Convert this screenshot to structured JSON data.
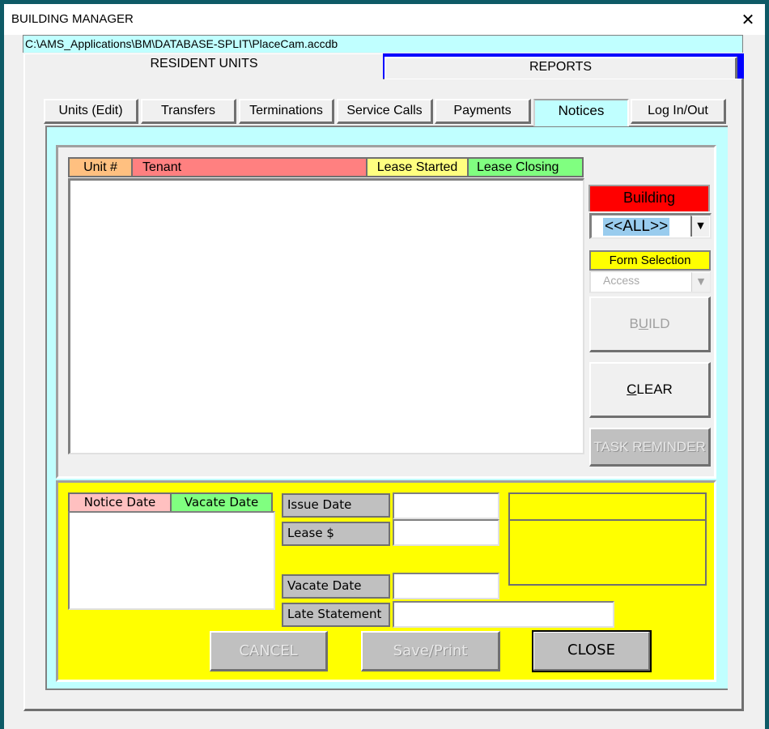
{
  "window": {
    "title": "BUILDING MANAGER",
    "close_glyph": "✕",
    "db_path": "C:\\AMS_Applications\\BM\\DATABASE-SPLIT\\PlaceCam.accdb"
  },
  "main_tabs": [
    {
      "label": "RESIDENT UNITS",
      "active": true
    },
    {
      "label": "REPORTS",
      "active": false
    }
  ],
  "sub_tabs": [
    {
      "label": "Units (Edit)",
      "active": false
    },
    {
      "label": "Transfers",
      "active": false
    },
    {
      "label": "Terminations",
      "active": false
    },
    {
      "label": "Service Calls",
      "active": false
    },
    {
      "label": "Payments",
      "active": false
    },
    {
      "label": "Notices",
      "active": true
    },
    {
      "label": "Log In/Out",
      "active": false
    }
  ],
  "units_list": {
    "columns": [
      {
        "label": "Unit #",
        "color": "#ffc080"
      },
      {
        "label": "Tenant",
        "color": "#ff8080"
      },
      {
        "label": "Lease Started",
        "color": "#ffff80"
      },
      {
        "label": "Lease Closing",
        "color": "#80ff80"
      }
    ],
    "rows": []
  },
  "building": {
    "label": "Building",
    "label_color": "#ff0000",
    "selected": "<<ALL>>",
    "dropdown_glyph": "▼"
  },
  "form_selection": {
    "label": "Form Selection",
    "label_color": "#ffff00",
    "selected": "Access",
    "dropdown_glyph": "▼"
  },
  "buttons": {
    "build": {
      "pre": "B",
      "hot": "U",
      "post": "ILD",
      "enabled": false
    },
    "clear": {
      "pre": "",
      "hot": "C",
      "post": "LEAR",
      "enabled": true
    },
    "task_reminder": {
      "label": "TASK REMINDER",
      "enabled": false
    },
    "cancel": {
      "label": "CANCEL",
      "enabled": false
    },
    "save_print": {
      "label": "Save/Print",
      "enabled": false
    },
    "close": {
      "label": "CLOSE",
      "enabled": true
    }
  },
  "notices_list": {
    "columns": [
      {
        "label": "Notice Date",
        "color": "#ffc0c0"
      },
      {
        "label": "Vacate Date",
        "color": "#80ff80"
      }
    ],
    "rows": []
  },
  "fields": {
    "issue_date": {
      "label": "Issue Date",
      "value": ""
    },
    "lease_amount": {
      "label": "Lease $",
      "value": ""
    },
    "vacate_date": {
      "label": "Vacate Date",
      "value": ""
    },
    "late_statement": {
      "label": "Late Statement",
      "value": ""
    }
  },
  "colors": {
    "notice_panel": "#ffff00",
    "tab_panel": "#c0ffff",
    "reports_tab_accent": "#0000ff"
  }
}
